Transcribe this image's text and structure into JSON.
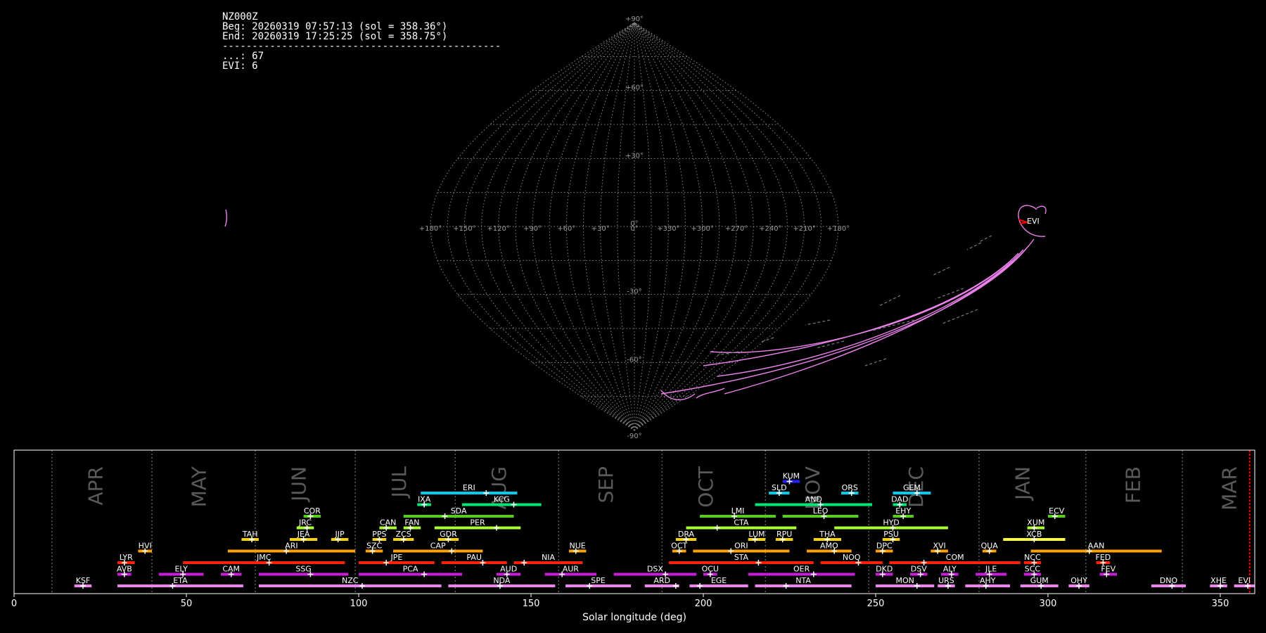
{
  "info": {
    "station": "NZ000Z",
    "begin": "Beg: 20260319 07:57:13 (sol = 358.36°)",
    "end": "End: 20260319 17:25:25 (sol = 358.75°)",
    "divider": "-----------------------------------------------",
    "count_other": "...: 67",
    "count_evi": "EVI: 6"
  },
  "colors": {
    "background": "#000000",
    "grid": "#8a8a8a",
    "frame": "#ffffff",
    "evi_track": "#ee82ee",
    "radiant_marker": "#ff0000",
    "current_sol_line": "#ff0000"
  },
  "sky_map": {
    "projection": "sinusoidal",
    "lat_labels": [
      "+90°",
      "+60°",
      "+30°",
      "0°",
      "-30°",
      "-60°",
      "-90°"
    ],
    "lon_labels": [
      "+180°",
      "+150°",
      "+120°",
      "+90°",
      "+60°",
      "+30°",
      "0°",
      "+330°",
      "+300°",
      "+270°",
      "+240°",
      "+210°",
      "+180°"
    ],
    "evi_label": "EVI"
  },
  "chart_data": {
    "type": "timeline",
    "xlabel": "Solar longitude (deg)",
    "xlim": [
      0,
      360
    ],
    "xticks": [
      0,
      50,
      100,
      150,
      200,
      250,
      300,
      350
    ],
    "current_sol": 358.5,
    "months": [
      {
        "name": "APR",
        "sol": 24
      },
      {
        "name": "MAY",
        "sol": 54
      },
      {
        "name": "JUN",
        "sol": 83
      },
      {
        "name": "JUL",
        "sol": 112
      },
      {
        "name": "AUG",
        "sol": 141
      },
      {
        "name": "SEP",
        "sol": 172
      },
      {
        "name": "OCT",
        "sol": 201
      },
      {
        "name": "NOV",
        "sol": 232
      },
      {
        "name": "DEC",
        "sol": 262
      },
      {
        "name": "JAN",
        "sol": 293
      },
      {
        "name": "FEB",
        "sol": 325
      },
      {
        "name": "MAR",
        "sol": 353
      }
    ],
    "month_boundaries": [
      11,
      40,
      70,
      99,
      128,
      158,
      188,
      218,
      248,
      280,
      311,
      339
    ],
    "showers": [
      {
        "code": "KSF",
        "start": 17.5,
        "end": 22.5,
        "peak": 20,
        "row": 0,
        "color": "#ee82ee"
      },
      {
        "code": "ETA",
        "start": 30,
        "end": 66.5,
        "peak": 46,
        "row": 0,
        "color": "#ee82ee"
      },
      {
        "code": "NZC",
        "start": 71,
        "end": 124,
        "peak": 101,
        "row": 0,
        "color": "#ee82ee"
      },
      {
        "code": "NDA",
        "start": 126,
        "end": 157,
        "peak": 141,
        "row": 0,
        "color": "#ee82ee"
      },
      {
        "code": "SPE",
        "start": 160,
        "end": 179,
        "peak": 167,
        "row": 0,
        "color": "#ee82ee"
      },
      {
        "code": "ARD",
        "start": 183,
        "end": 193,
        "peak": 192,
        "row": 0,
        "color": "#ee82ee"
      },
      {
        "code": "EGE",
        "start": 196,
        "end": 213,
        "peak": 199,
        "row": 0,
        "color": "#ee82ee"
      },
      {
        "code": "NTA",
        "start": 215,
        "end": 243,
        "peak": 224,
        "row": 0,
        "color": "#ee82ee"
      },
      {
        "code": "MON",
        "start": 250,
        "end": 267,
        "peak": 262,
        "row": 0,
        "color": "#ee82ee"
      },
      {
        "code": "URS",
        "start": 268,
        "end": 273,
        "peak": 271,
        "row": 0,
        "color": "#ee82ee"
      },
      {
        "code": "AHY",
        "start": 276,
        "end": 289,
        "peak": 282,
        "row": 0,
        "color": "#ee82ee"
      },
      {
        "code": "GUM",
        "start": 292,
        "end": 303,
        "peak": 298,
        "row": 0,
        "color": "#ee82ee"
      },
      {
        "code": "OHY",
        "start": 306,
        "end": 312,
        "peak": 309,
        "row": 0,
        "color": "#ee82ee"
      },
      {
        "code": "DNO",
        "start": 330,
        "end": 340,
        "peak": 336,
        "row": 0,
        "color": "#ee82ee"
      },
      {
        "code": "XHE",
        "start": 347,
        "end": 352,
        "peak": 350,
        "row": 0,
        "color": "#ee82ee"
      },
      {
        "code": "EVI",
        "start": 354,
        "end": 360,
        "peak": 358,
        "row": 0,
        "color": "#ee82ee"
      },
      {
        "code": "AVB",
        "start": 30,
        "end": 34,
        "peak": 32,
        "row": 1,
        "color": "#c71fd9"
      },
      {
        "code": "ELY",
        "start": 42,
        "end": 55,
        "peak": 49,
        "row": 1,
        "color": "#c71fd9"
      },
      {
        "code": "CAM",
        "start": 60,
        "end": 66,
        "peak": 63,
        "row": 1,
        "color": "#c71fd9"
      },
      {
        "code": "SSG",
        "start": 71,
        "end": 97,
        "peak": 86,
        "row": 1,
        "color": "#c71fd9"
      },
      {
        "code": "PCA",
        "start": 100,
        "end": 130,
        "peak": 119,
        "row": 1,
        "color": "#c71fd9"
      },
      {
        "code": "AUD",
        "start": 140,
        "end": 147,
        "peak": 143,
        "row": 1,
        "color": "#c71fd9"
      },
      {
        "code": "AUR",
        "start": 154,
        "end": 169,
        "peak": 159,
        "row": 1,
        "color": "#c71fd9"
      },
      {
        "code": "DSX",
        "start": 174,
        "end": 198,
        "peak": 189,
        "row": 1,
        "color": "#c71fd9"
      },
      {
        "code": "OCU",
        "start": 200,
        "end": 204,
        "peak": 202,
        "row": 1,
        "color": "#c71fd9"
      },
      {
        "code": "OER",
        "start": 213,
        "end": 244,
        "peak": 232,
        "row": 1,
        "color": "#c71fd9"
      },
      {
        "code": "DKD",
        "start": 250,
        "end": 255,
        "peak": 252,
        "row": 1,
        "color": "#c71fd9"
      },
      {
        "code": "DSV",
        "start": 260,
        "end": 265,
        "peak": 263,
        "row": 1,
        "color": "#c71fd9"
      },
      {
        "code": "ALY",
        "start": 269,
        "end": 274,
        "peak": 272,
        "row": 1,
        "color": "#c71fd9"
      },
      {
        "code": "JLE",
        "start": 279,
        "end": 288,
        "peak": 283,
        "row": 1,
        "color": "#c71fd9"
      },
      {
        "code": "SCC",
        "start": 293,
        "end": 298,
        "peak": 296,
        "row": 1,
        "color": "#c71fd9"
      },
      {
        "code": "FEV",
        "start": 315,
        "end": 320,
        "peak": 317,
        "row": 1,
        "color": "#c71fd9"
      },
      {
        "code": "LYR",
        "start": 30,
        "end": 35,
        "peak": 32,
        "row": 2,
        "color": "#ff2200"
      },
      {
        "code": "JMC",
        "start": 49,
        "end": 96,
        "peak": 74,
        "row": 2,
        "color": "#ff2200"
      },
      {
        "code": "JPE",
        "start": 100,
        "end": 122,
        "peak": 108,
        "row": 2,
        "color": "#ff2200"
      },
      {
        "code": "PAU",
        "start": 124,
        "end": 143,
        "peak": 136,
        "row": 2,
        "color": "#ff2200"
      },
      {
        "code": "NIA",
        "start": 145,
        "end": 165,
        "peak": 148,
        "row": 2,
        "color": "#ff2200"
      },
      {
        "code": "STA",
        "start": 190,
        "end": 232,
        "peak": 216,
        "row": 2,
        "color": "#ff2200"
      },
      {
        "code": "NOO",
        "start": 234,
        "end": 252,
        "peak": 245,
        "row": 2,
        "color": "#ff2200"
      },
      {
        "code": "COM",
        "start": 254,
        "end": 292,
        "peak": 264,
        "row": 2,
        "color": "#ff2200"
      },
      {
        "code": "NCC",
        "start": 293,
        "end": 298,
        "peak": 296,
        "row": 2,
        "color": "#ff2200"
      },
      {
        "code": "FED",
        "start": 314,
        "end": 318,
        "peak": 316,
        "row": 2,
        "color": "#ff2200"
      },
      {
        "code": "HVI",
        "start": 36,
        "end": 40,
        "peak": 38,
        "row": 3,
        "color": "#ff9f00"
      },
      {
        "code": "ARI",
        "start": 62,
        "end": 99,
        "peak": 79,
        "row": 3,
        "color": "#ff9f00"
      },
      {
        "code": "SZC",
        "start": 102,
        "end": 107,
        "peak": 104,
        "row": 3,
        "color": "#ff9f00"
      },
      {
        "code": "CAP",
        "start": 110,
        "end": 136,
        "peak": 127,
        "row": 3,
        "color": "#ff9f00"
      },
      {
        "code": "NUE",
        "start": 161,
        "end": 166,
        "peak": 163,
        "row": 3,
        "color": "#ff9f00"
      },
      {
        "code": "OCT",
        "start": 191,
        "end": 195,
        "peak": 193,
        "row": 3,
        "color": "#ff9f00"
      },
      {
        "code": "ORI",
        "start": 197,
        "end": 225,
        "peak": 208,
        "row": 3,
        "color": "#ff9f00"
      },
      {
        "code": "AMO",
        "start": 230,
        "end": 243,
        "peak": 238,
        "row": 3,
        "color": "#ff9f00"
      },
      {
        "code": "DPC",
        "start": 250,
        "end": 255,
        "peak": 252,
        "row": 3,
        "color": "#ff9f00"
      },
      {
        "code": "XVI",
        "start": 266,
        "end": 271,
        "peak": 268,
        "row": 3,
        "color": "#ff9f00"
      },
      {
        "code": "QUA",
        "start": 281,
        "end": 285,
        "peak": 283,
        "row": 3,
        "color": "#ff9f00"
      },
      {
        "code": "AAN",
        "start": 295,
        "end": 333,
        "peak": 312,
        "row": 3,
        "color": "#ff9f00"
      },
      {
        "code": "TAH",
        "start": 66,
        "end": 71,
        "peak": 69,
        "row": 4,
        "color": "#f5d200"
      },
      {
        "code": "JEA",
        "start": 80,
        "end": 88,
        "peak": 84,
        "row": 4,
        "color": "#f5d200"
      },
      {
        "code": "JIP",
        "start": 92,
        "end": 97,
        "peak": 94,
        "row": 4,
        "color": "#f5d200"
      },
      {
        "code": "PPS",
        "start": 104,
        "end": 108,
        "peak": 106,
        "row": 4,
        "color": "#f5d200"
      },
      {
        "code": "ZCS",
        "start": 110,
        "end": 116,
        "peak": 113,
        "row": 4,
        "color": "#f5d200"
      },
      {
        "code": "GDR",
        "start": 123,
        "end": 129,
        "peak": 126,
        "row": 4,
        "color": "#f5d200"
      },
      {
        "code": "DRA",
        "start": 192,
        "end": 198,
        "peak": 195,
        "row": 4,
        "color": "#f5d200"
      },
      {
        "code": "LUM",
        "start": 213,
        "end": 218,
        "peak": 215,
        "row": 4,
        "color": "#f5d200"
      },
      {
        "code": "RPU",
        "start": 221,
        "end": 226,
        "peak": 223,
        "row": 4,
        "color": "#f5d200"
      },
      {
        "code": "THA",
        "start": 232,
        "end": 240,
        "peak": 236,
        "row": 4,
        "color": "#f5d200"
      },
      {
        "code": "PSU",
        "start": 252,
        "end": 257,
        "peak": 255,
        "row": 4,
        "color": "#f5d200"
      },
      {
        "code": "XCB",
        "start": 287,
        "end": 305,
        "peak": 296,
        "row": 4,
        "color": "#ffff3a"
      },
      {
        "code": "JRC",
        "start": 82,
        "end": 87,
        "peak": 85,
        "row": 5,
        "color": "#aaff33"
      },
      {
        "code": "CAN",
        "start": 106,
        "end": 111,
        "peak": 108,
        "row": 5,
        "color": "#aaff33"
      },
      {
        "code": "FAN",
        "start": 113,
        "end": 118,
        "peak": 115,
        "row": 5,
        "color": "#aaff33"
      },
      {
        "code": "PER",
        "start": 122,
        "end": 147,
        "peak": 140,
        "row": 5,
        "color": "#aaff33"
      },
      {
        "code": "CTA",
        "start": 195,
        "end": 227,
        "peak": 204,
        "row": 5,
        "color": "#aaff33"
      },
      {
        "code": "HYD",
        "start": 238,
        "end": 271,
        "peak": 255,
        "row": 5,
        "color": "#aaff33"
      },
      {
        "code": "XUM",
        "start": 294,
        "end": 299,
        "peak": 296,
        "row": 5,
        "color": "#aaff33"
      },
      {
        "code": "COR",
        "start": 84,
        "end": 89,
        "peak": 86,
        "row": 6,
        "color": "#55cc22"
      },
      {
        "code": "SDA",
        "start": 113,
        "end": 145,
        "peak": 125,
        "row": 6,
        "color": "#55cc22"
      },
      {
        "code": "LMI",
        "start": 199,
        "end": 221,
        "peak": 209,
        "row": 6,
        "color": "#55cc22"
      },
      {
        "code": "LEO",
        "start": 223,
        "end": 245,
        "peak": 235,
        "row": 6,
        "color": "#55cc22"
      },
      {
        "code": "EHY",
        "start": 255,
        "end": 261,
        "peak": 258,
        "row": 6,
        "color": "#55cc22"
      },
      {
        "code": "ECV",
        "start": 300,
        "end": 305,
        "peak": 302,
        "row": 6,
        "color": "#55cc22"
      },
      {
        "code": "IXA",
        "start": 117,
        "end": 121,
        "peak": 119,
        "row": 7,
        "color": "#00e676"
      },
      {
        "code": "KCG",
        "start": 130,
        "end": 153,
        "peak": 145,
        "row": 7,
        "color": "#00e676"
      },
      {
        "code": "AND",
        "start": 215,
        "end": 249,
        "peak": 234,
        "row": 7,
        "color": "#00e676"
      },
      {
        "code": "DAD",
        "start": 255,
        "end": 259,
        "peak": 257,
        "row": 7,
        "color": "#00e676"
      },
      {
        "code": "ERI",
        "start": 118,
        "end": 146,
        "peak": 137,
        "row": 8,
        "color": "#00ccee"
      },
      {
        "code": "SLD",
        "start": 219,
        "end": 225,
        "peak": 222,
        "row": 8,
        "color": "#00ccee"
      },
      {
        "code": "ORS",
        "start": 240,
        "end": 245,
        "peak": 243,
        "row": 8,
        "color": "#00ccee"
      },
      {
        "code": "GEM",
        "start": 255,
        "end": 266,
        "peak": 262,
        "row": 8,
        "color": "#00ccee"
      },
      {
        "code": "KUM",
        "start": 223,
        "end": 228,
        "peak": 225,
        "row": 9,
        "color": "#2222ff"
      }
    ]
  }
}
